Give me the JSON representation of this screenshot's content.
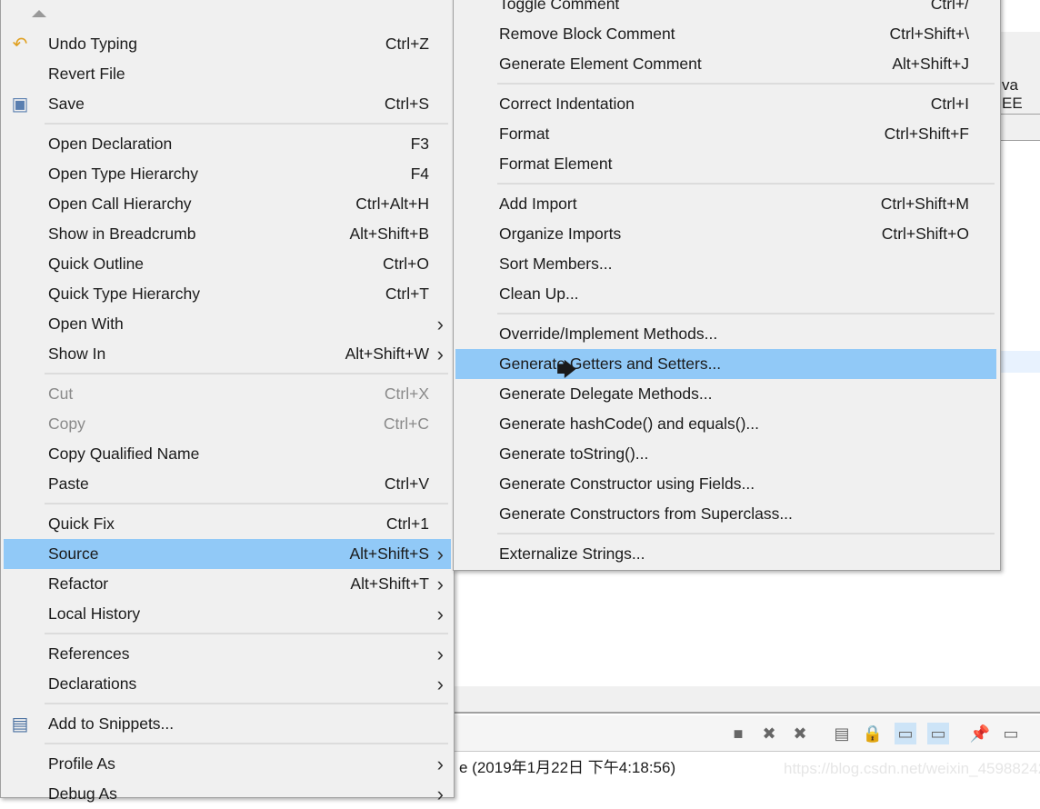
{
  "background": {
    "perspective_label": "va EE",
    "status_text": "e (2019年1月22日 下午4:18:56)",
    "watermark": "https://blog.csdn.net/weixin_45988242"
  },
  "toolbar_icons": [
    "terminate-icon",
    "remove-icon",
    "remove-all-icon",
    "clear-console-icon",
    "scroll-lock-icon",
    "show-on-stdout-icon",
    "show-on-stderr-icon",
    "pin-console-icon",
    "display-console-icon"
  ],
  "colors": {
    "highlight": "#91c9f7",
    "menu_bg": "#f0f0f0"
  },
  "context_menu": {
    "items": [
      {
        "label": "Undo Typing",
        "shortcut": "Ctrl+Z",
        "icon": "undo-icon"
      },
      {
        "label": "Revert File",
        "shortcut": ""
      },
      {
        "label": "Save",
        "shortcut": "Ctrl+S",
        "icon": "save-icon"
      },
      {
        "sep": true
      },
      {
        "label": "Open Declaration",
        "shortcut": "F3"
      },
      {
        "label": "Open Type Hierarchy",
        "shortcut": "F4"
      },
      {
        "label": "Open Call Hierarchy",
        "shortcut": "Ctrl+Alt+H"
      },
      {
        "label": "Show in Breadcrumb",
        "shortcut": "Alt+Shift+B"
      },
      {
        "label": "Quick Outline",
        "shortcut": "Ctrl+O"
      },
      {
        "label": "Quick Type Hierarchy",
        "shortcut": "Ctrl+T"
      },
      {
        "label": "Open With",
        "shortcut": "",
        "submenu": true
      },
      {
        "label": "Show In",
        "shortcut": "Alt+Shift+W",
        "submenu": true
      },
      {
        "sep": true
      },
      {
        "label": "Cut",
        "shortcut": "Ctrl+X",
        "disabled": true
      },
      {
        "label": "Copy",
        "shortcut": "Ctrl+C",
        "disabled": true
      },
      {
        "label": "Copy Qualified Name",
        "shortcut": ""
      },
      {
        "label": "Paste",
        "shortcut": "Ctrl+V"
      },
      {
        "sep": true
      },
      {
        "label": "Quick Fix",
        "shortcut": "Ctrl+1"
      },
      {
        "label": "Source",
        "shortcut": "Alt+Shift+S",
        "submenu": true,
        "highlighted": true
      },
      {
        "label": "Refactor",
        "shortcut": "Alt+Shift+T",
        "submenu": true
      },
      {
        "label": "Local History",
        "shortcut": "",
        "submenu": true
      },
      {
        "sep": true
      },
      {
        "label": "References",
        "shortcut": "",
        "submenu": true
      },
      {
        "label": "Declarations",
        "shortcut": "",
        "submenu": true
      },
      {
        "sep": true
      },
      {
        "label": "Add to Snippets...",
        "shortcut": "",
        "icon": "snippets-icon"
      },
      {
        "sep": true
      },
      {
        "label": "Profile As",
        "shortcut": "",
        "submenu": true
      },
      {
        "label": "Debug As",
        "shortcut": "",
        "submenu": true
      }
    ]
  },
  "source_submenu": {
    "items": [
      {
        "label": "Toggle Comment",
        "shortcut": "Ctrl+/"
      },
      {
        "label": "Remove Block Comment",
        "shortcut": "Ctrl+Shift+\\"
      },
      {
        "label": "Generate Element Comment",
        "shortcut": "Alt+Shift+J"
      },
      {
        "sep": true
      },
      {
        "label": "Correct Indentation",
        "shortcut": "Ctrl+I"
      },
      {
        "label": "Format",
        "shortcut": "Ctrl+Shift+F"
      },
      {
        "label": "Format Element",
        "shortcut": ""
      },
      {
        "sep": true
      },
      {
        "label": "Add Import",
        "shortcut": "Ctrl+Shift+M"
      },
      {
        "label": "Organize Imports",
        "shortcut": "Ctrl+Shift+O"
      },
      {
        "label": "Sort Members...",
        "shortcut": ""
      },
      {
        "label": "Clean Up...",
        "shortcut": ""
      },
      {
        "sep": true
      },
      {
        "label": "Override/Implement Methods...",
        "shortcut": ""
      },
      {
        "label": "Generate Getters and Setters...",
        "shortcut": "",
        "highlighted": true
      },
      {
        "label": "Generate Delegate Methods...",
        "shortcut": ""
      },
      {
        "label": "Generate hashCode() and equals()...",
        "shortcut": ""
      },
      {
        "label": "Generate toString()...",
        "shortcut": ""
      },
      {
        "label": "Generate Constructor using Fields...",
        "shortcut": ""
      },
      {
        "label": "Generate Constructors from Superclass...",
        "shortcut": ""
      },
      {
        "sep": true
      },
      {
        "label": "Externalize Strings...",
        "shortcut": ""
      }
    ]
  }
}
